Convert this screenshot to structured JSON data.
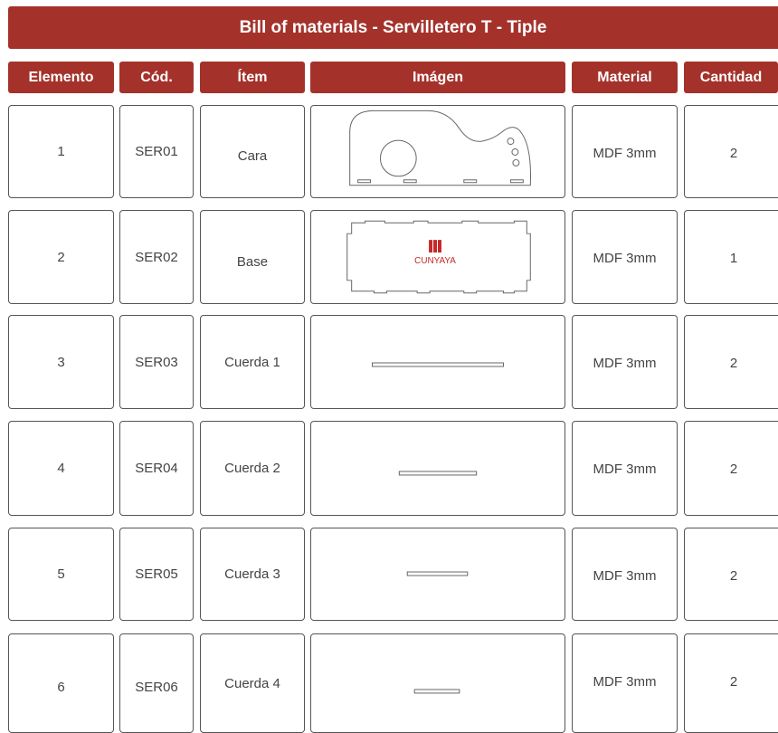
{
  "title": "Bill of materials - Servilletero T - Tiple",
  "columns": [
    "Elemento",
    "Cód.",
    "Ítem",
    "Imágen",
    "Material",
    "Cantidad"
  ],
  "rows": [
    {
      "elemento": "1",
      "codigo": "SER01",
      "item": "Cara",
      "image": "face-piece-drawing",
      "material": "MDF 3mm",
      "cantidad": "2"
    },
    {
      "elemento": "2",
      "codigo": "SER02",
      "item": "Base",
      "image": "base-piece-drawing",
      "material": "MDF 3mm",
      "cantidad": "1",
      "logo_text": "CUNYAYA"
    },
    {
      "elemento": "3",
      "codigo": "SER03",
      "item": "Cuerda 1",
      "image": "string-bar-long",
      "material": "MDF 3mm",
      "cantidad": "2"
    },
    {
      "elemento": "4",
      "codigo": "SER04",
      "item": "Cuerda 2",
      "image": "string-bar-medium",
      "material": "MDF 3mm",
      "cantidad": "2"
    },
    {
      "elemento": "5",
      "codigo": "SER05",
      "item": "Cuerda 3",
      "image": "string-bar-short",
      "material": "MDF 3mm",
      "cantidad": "2"
    },
    {
      "elemento": "6",
      "codigo": "SER06",
      "item": "Cuerda 4",
      "image": "string-bar-shortest",
      "material": "MDF 3mm",
      "cantidad": "2"
    }
  ],
  "colors": {
    "header_bg": "#a4322b",
    "header_text": "#ffffff",
    "logo_red": "#c62828"
  }
}
